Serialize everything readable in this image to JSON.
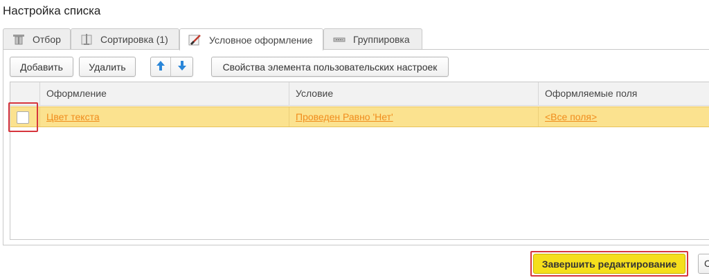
{
  "window": {
    "title": "Настройка списка"
  },
  "tabs": [
    {
      "label": "Отбор",
      "icon": "filter-icon"
    },
    {
      "label": "Сортировка (1)",
      "icon": "sort-icon"
    },
    {
      "label": "Условное оформление",
      "icon": "brush-icon",
      "active": true
    },
    {
      "label": "Группировка",
      "icon": "grouping-icon"
    }
  ],
  "toolbar": {
    "add_label": "Добавить",
    "delete_label": "Удалить",
    "up_icon": "arrow-up-icon",
    "down_icon": "arrow-down-icon",
    "properties_label": "Свойства элемента пользовательских настроек"
  },
  "table": {
    "columns": [
      "Оформление",
      "Условие",
      "Оформляемые поля"
    ],
    "rows": [
      {
        "appearance": "Цвет текста",
        "condition": "Проведен Равно 'Нет'",
        "fields": "<Все поля>",
        "checked": false
      }
    ]
  },
  "footer": {
    "finish_label": "Завершить редактирование",
    "next_label": "С"
  },
  "colors": {
    "accent_button": "#f5df1c",
    "selected_row": "#fbe28f",
    "link": "#f08c1c",
    "highlight": "#d6343c",
    "arrow": "#2a86d8"
  }
}
